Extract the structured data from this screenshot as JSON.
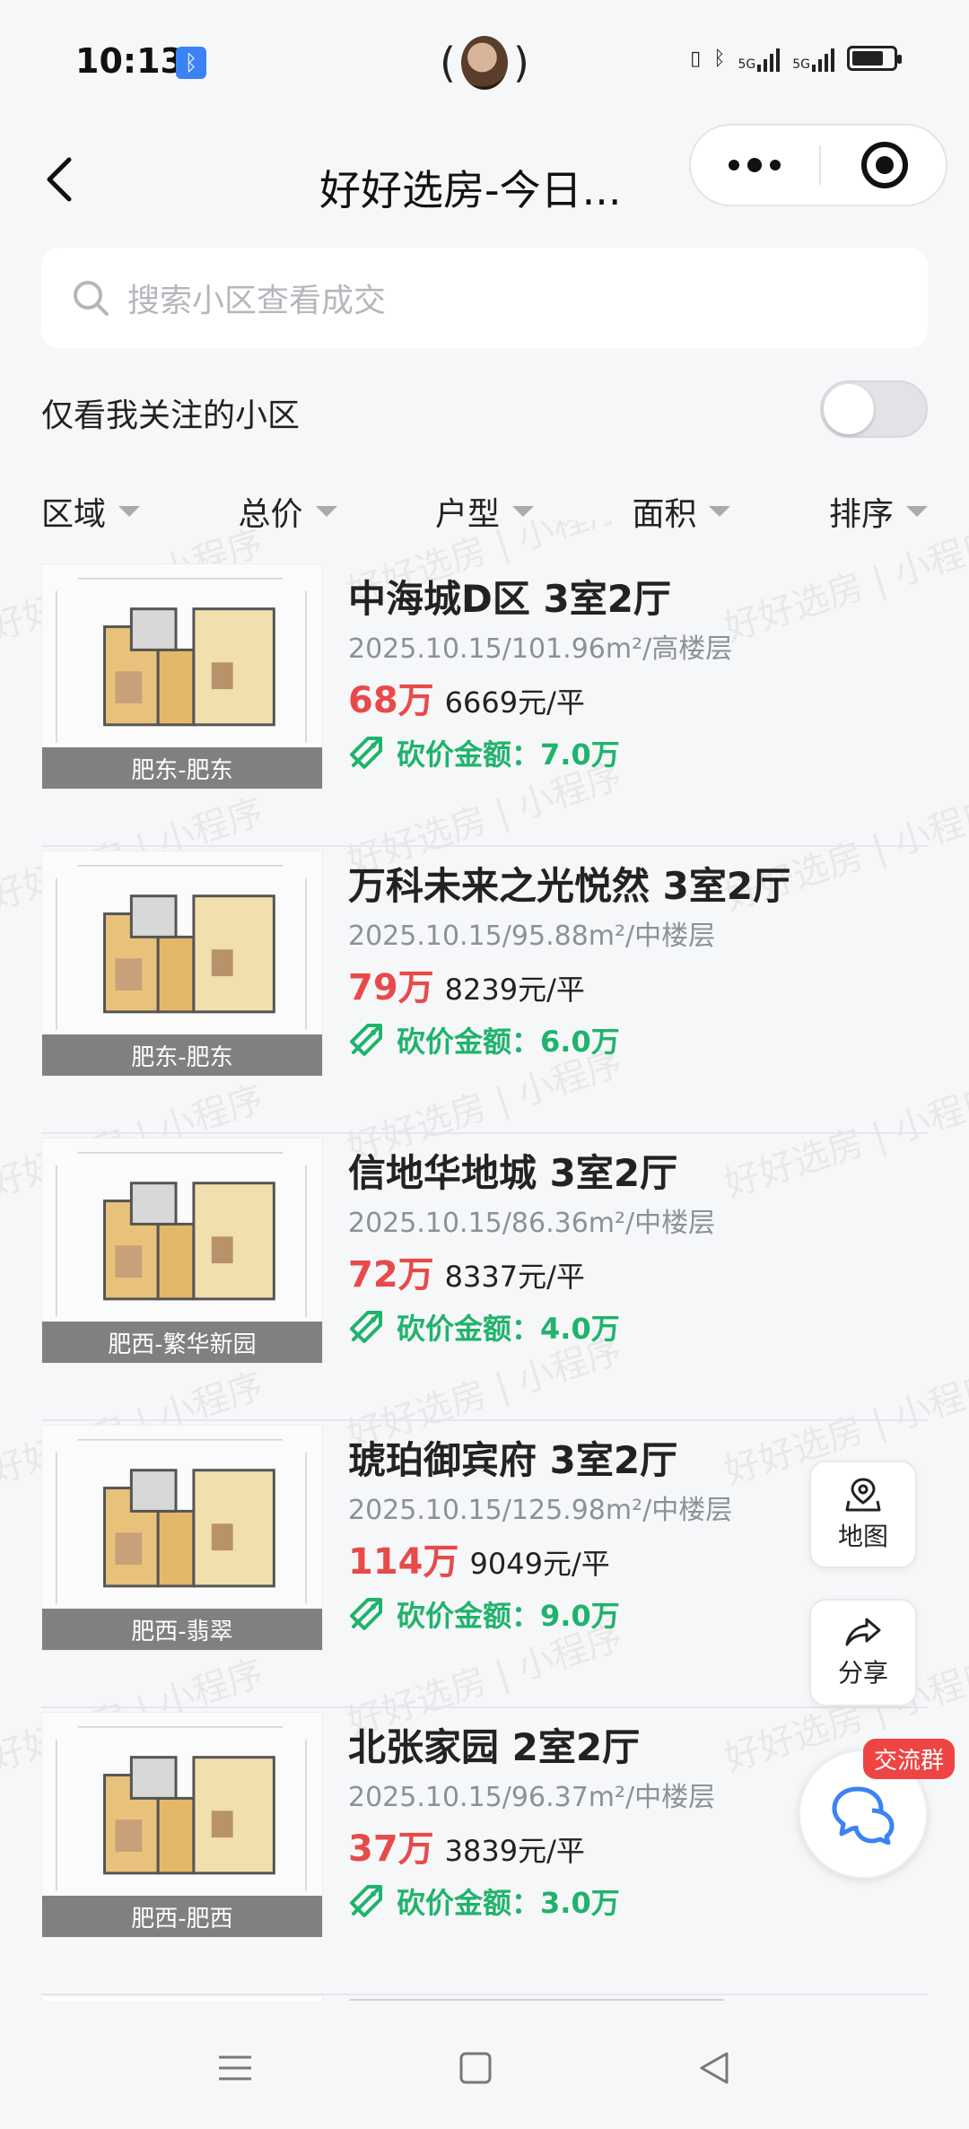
{
  "status_bar": {
    "time": "10:13",
    "network_1": "5G",
    "network_2": "5G"
  },
  "header": {
    "title": "好好选房-今日..."
  },
  "search": {
    "placeholder": "搜索小区查看成交"
  },
  "follow_toggle": {
    "label": "仅看我关注的小区",
    "on": false
  },
  "filters": [
    {
      "label": "区域"
    },
    {
      "label": "总价"
    },
    {
      "label": "户型"
    },
    {
      "label": "面积"
    },
    {
      "label": "排序"
    }
  ],
  "listings": [
    {
      "name": "中海城D区 3室2厅",
      "date": "2025.10.15",
      "area": "101.96m²",
      "floor": "高楼层",
      "total_price": "68万",
      "unit_price": "6669元/平",
      "cut_label": "砍价金额：",
      "cut_amount": "7.0万",
      "area_tag": "肥东-肥东"
    },
    {
      "name": "万科未来之光悦然 3室2厅",
      "date": "2025.10.15",
      "area": "95.88m²",
      "floor": "中楼层",
      "total_price": "79万",
      "unit_price": "8239元/平",
      "cut_label": "砍价金额：",
      "cut_amount": "6.0万",
      "area_tag": "肥东-肥东"
    },
    {
      "name": "信地华地城 3室2厅",
      "date": "2025.10.15",
      "area": "86.36m²",
      "floor": "中楼层",
      "total_price": "72万",
      "unit_price": "8337元/平",
      "cut_label": "砍价金额：",
      "cut_amount": "4.0万",
      "area_tag": "肥西-繁华新园"
    },
    {
      "name": "琥珀御宾府 3室2厅",
      "date": "2025.10.15",
      "area": "125.98m²",
      "floor": "中楼层",
      "total_price": "114万",
      "unit_price": "9049元/平",
      "cut_label": "砍价金额：",
      "cut_amount": "9.0万",
      "area_tag": "肥西-翡翠"
    },
    {
      "name": "北张家园 2室2厅",
      "date": "2025.10.15",
      "area": "96.37m²",
      "floor": "中楼层",
      "total_price": "37万",
      "unit_price": "3839元/平",
      "cut_label": "砍价金额：",
      "cut_amount": "3.0万",
      "area_tag": "肥西-肥西"
    }
  ],
  "floating": {
    "map_label": "地图",
    "share_label": "分享",
    "chat_badge": "交流群"
  },
  "watermark": "好好选房 | 小程序",
  "colors": {
    "price_red": "#e84a4a",
    "cut_green": "#1fb36b",
    "accent_blue": "#3b82f6",
    "badge_red": "#ef4444"
  }
}
